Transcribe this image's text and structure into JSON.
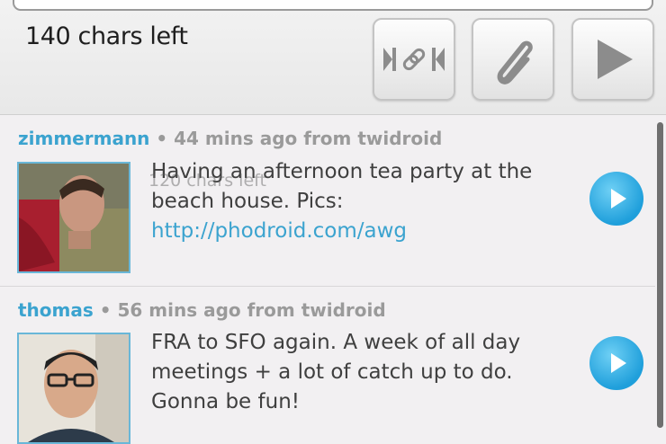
{
  "compose": {
    "chars_left": "140 chars left",
    "buttons": [
      {
        "icon": "shorten-link-icon"
      },
      {
        "icon": "paperclip-icon"
      },
      {
        "icon": "send-arrow-icon"
      }
    ]
  },
  "timeline": {
    "tweets": [
      {
        "user": "zimmermann",
        "meta": " • 44 mins ago from twidroid",
        "text": "Having an afternoon tea party at the beach house. Pics: ",
        "link": "http://phodroid.com/awg",
        "overlay_text": "120 chars left",
        "avatar_icon": "user-avatar"
      },
      {
        "user": "thomas",
        "meta": " • 56 mins ago from twidroid",
        "text": "FRA to SFO again. A week of all day meetings + a lot of catch up to do. Gonna be fun!",
        "avatar_icon": "user-avatar"
      }
    ]
  },
  "colors": {
    "accent": "#3ba3cf",
    "meta_text": "#9a9a9a",
    "play_button": "#1f9fdb"
  }
}
